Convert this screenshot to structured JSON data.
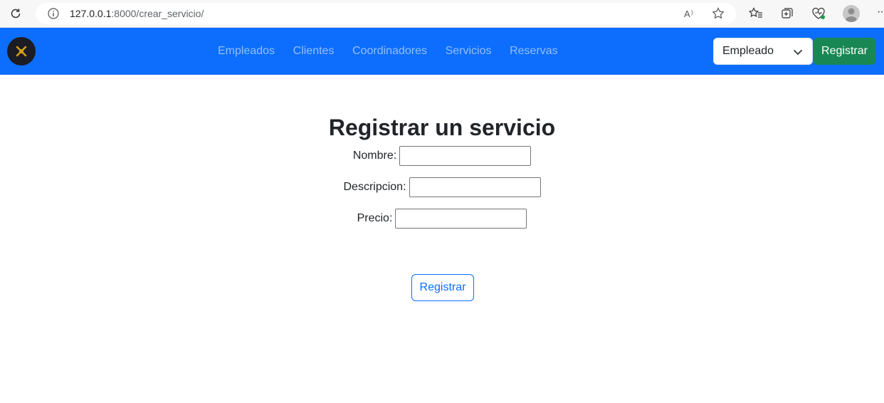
{
  "browser": {
    "url_host": "127.0.0.1",
    "url_rest": ":8000/crear_servicio/"
  },
  "navbar": {
    "links": [
      "Empleados",
      "Clientes",
      "Coordinadores",
      "Servicios",
      "Reservas"
    ],
    "select_value": "Empleado",
    "register_button": "Registrar",
    "bg_color": "#0d6efd",
    "button_color": "#198754"
  },
  "form": {
    "title": "Registrar un servicio",
    "fields": [
      {
        "label": "Nombre:",
        "value": ""
      },
      {
        "label": "Descripcion:",
        "value": ""
      },
      {
        "label": "Precio:",
        "value": ""
      }
    ],
    "submit_label": "Registrar"
  }
}
